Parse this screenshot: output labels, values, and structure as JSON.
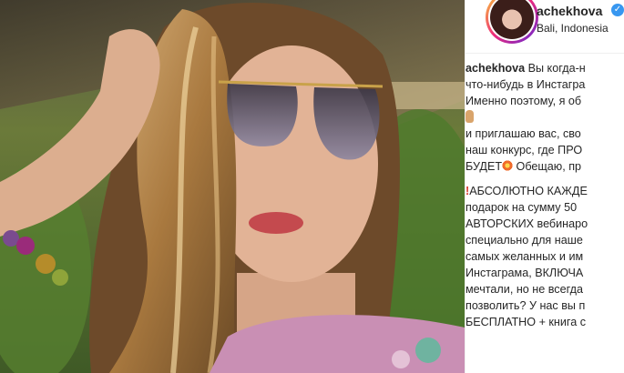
{
  "post": {
    "username": "achekhova",
    "location": "Bali, Indonesia",
    "verified_icon": "verified-badge-icon",
    "colors": {
      "verified": "#3897f0",
      "text": "#262626"
    }
  },
  "caption": {
    "line1_user": "achekhova",
    "line1_text": " Вы когда-н",
    "line2": "что-нибудь в Инстагра",
    "line3": "Именно поэтому, я об",
    "line5": "и приглашаю вас, сво",
    "line6": "наш конкурс, где ПРО",
    "line7_a": "БУДЕТ",
    "line7_b": "  Обещаю, пр",
    "line8_b": "АБСОЛЮТНО КАЖДЕ",
    "line9": "подарок на сумму 50",
    "line10": "АВТОРСКИХ вебинаро",
    "line11": "специально для наше",
    "line12": "самых желанных и им",
    "line13": "Инстаграма, ВКЛЮЧА",
    "line14": "мечтали, но не всегда",
    "line15": "позволить? У нас вы п",
    "line16": "БЕСПЛАТНО + книга с"
  }
}
